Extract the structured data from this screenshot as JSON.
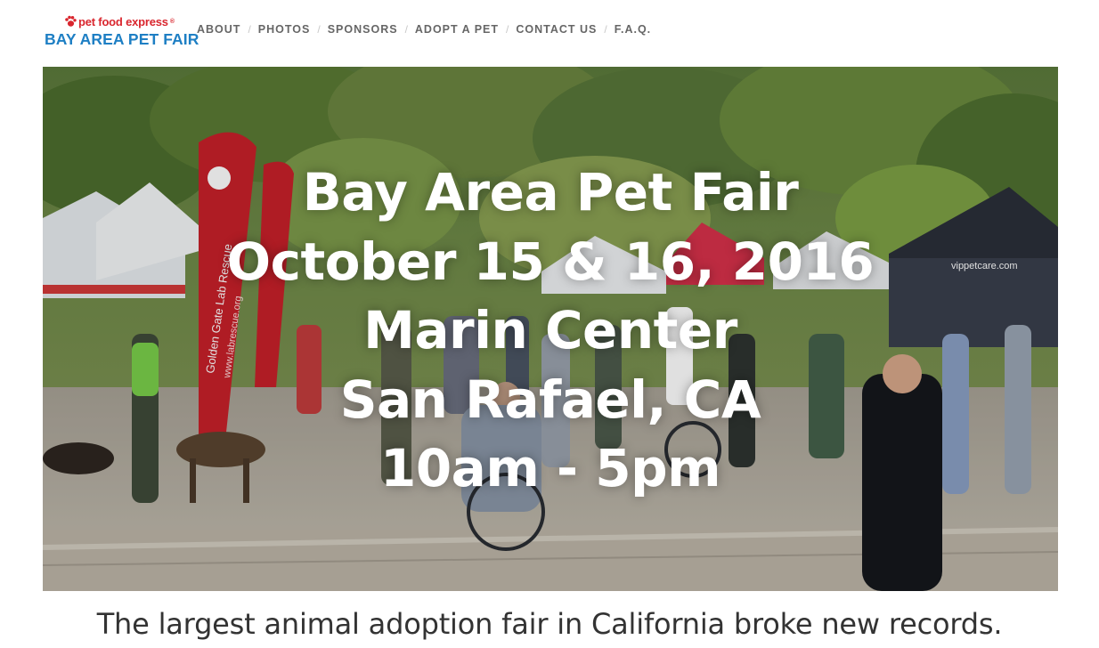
{
  "logo": {
    "brand": "pet food express",
    "registered": "®",
    "title": "BAY AREA PET FAIR"
  },
  "nav": {
    "items": [
      {
        "label": "ABOUT"
      },
      {
        "label": "PHOTOS"
      },
      {
        "label": "SPONSORS"
      },
      {
        "label": "ADOPT A PET"
      },
      {
        "label": "CONTACT US"
      },
      {
        "label": "F.A.Q."
      }
    ],
    "separator": "/"
  },
  "hero": {
    "lines": [
      "Bay Area Pet Fair",
      "October 15 & 16, 2016",
      "Marin Center",
      "San Rafael, CA",
      "10am - 5pm"
    ],
    "banner_text_1": "Golden Gate Lab Rescue",
    "banner_text_2": "www.labrescue.org",
    "tent_text": "vippetcare.com"
  },
  "tagline": "The largest animal adoption fair in California broke new records.",
  "colors": {
    "brand_red": "#d9262e",
    "brand_blue": "#1e7fc4",
    "nav_text": "#666666"
  }
}
